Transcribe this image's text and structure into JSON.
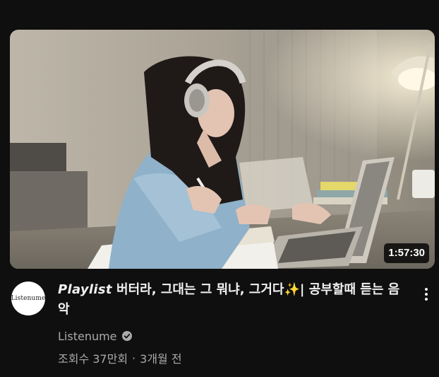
{
  "video": {
    "duration": "1:57:30",
    "title_prefix": "Playlist",
    "title_main": "버터라, 그대는 그 뭐냐, 그거다",
    "title_emoji": "✨",
    "title_suffix": "| 공부할때 듣는 음악",
    "channel_name": "Listenume",
    "channel_avatar_text": "Listenume",
    "views": "조회수 37만회",
    "separator": "·",
    "age": "3개월 전",
    "verified_icon": "verified-check-icon",
    "menu_icon": "more-vert-icon"
  }
}
